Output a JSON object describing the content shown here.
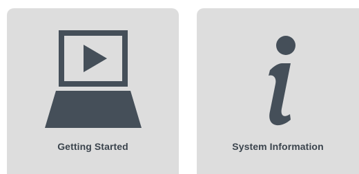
{
  "tiles": [
    {
      "label": "Getting Started",
      "icon": "laptop-play-icon"
    },
    {
      "label": "System Information",
      "icon": "info-icon"
    }
  ],
  "colors": {
    "tile_background": "#dddddd",
    "icon": "#454f59",
    "label": "#3b444d",
    "page_background": "#ffffff"
  }
}
